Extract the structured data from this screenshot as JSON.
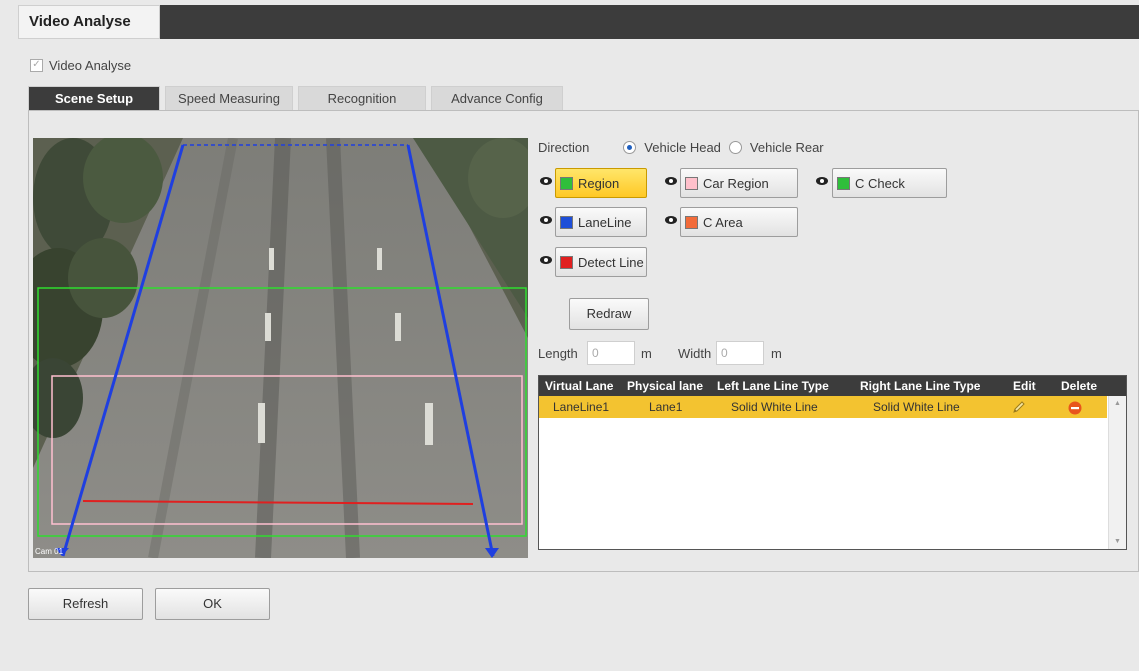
{
  "header": {
    "title": "Video Analyse"
  },
  "enable_checkbox": {
    "label": "Video Analyse",
    "checked": true
  },
  "tabs": [
    {
      "label": "Scene Setup",
      "active": true
    },
    {
      "label": "Speed Measuring",
      "active": false
    },
    {
      "label": "Recognition",
      "active": false
    },
    {
      "label": "Advance Config",
      "active": false
    }
  ],
  "video": {
    "overlay_corner_text": "Cam 01"
  },
  "direction": {
    "label": "Direction",
    "options": [
      {
        "label": "Vehicle Head",
        "selected": true
      },
      {
        "label": "Vehicle Rear",
        "selected": false
      }
    ]
  },
  "draw_buttons": [
    {
      "label": "Region",
      "color": "#2fbf3b",
      "active": true
    },
    {
      "label": "Car Region",
      "color": "#ffc0cb",
      "active": false
    },
    {
      "label": "C Check",
      "color": "#2fbf3b",
      "active": false
    },
    {
      "label": "LaneLine",
      "color": "#1f4fd8",
      "active": false
    },
    {
      "label": "C Area",
      "color": "#f26b3a",
      "active": false
    },
    {
      "label": "Detect Line",
      "color": "#e02020",
      "active": false
    }
  ],
  "redraw_label": "Redraw",
  "dimensions": {
    "length_label": "Length",
    "length_value": "0",
    "length_unit": "m",
    "width_label": "Width",
    "width_value": "0",
    "width_unit": "m"
  },
  "lane_table": {
    "columns": [
      "Virtual Lane",
      "Physical lane",
      "Left Lane Line Type",
      "Right Lane Line Type",
      "Edit",
      "Delete"
    ],
    "rows": [
      {
        "virtual_lane": "LaneLine1",
        "physical_lane": "Lane1",
        "left_type": "Solid White Line",
        "right_type": "Solid White Line"
      }
    ]
  },
  "footer": {
    "refresh_label": "Refresh",
    "ok_label": "OK"
  },
  "colors": {
    "accent_yellow": "#f3c330",
    "header_dark": "#3c3c3c"
  }
}
